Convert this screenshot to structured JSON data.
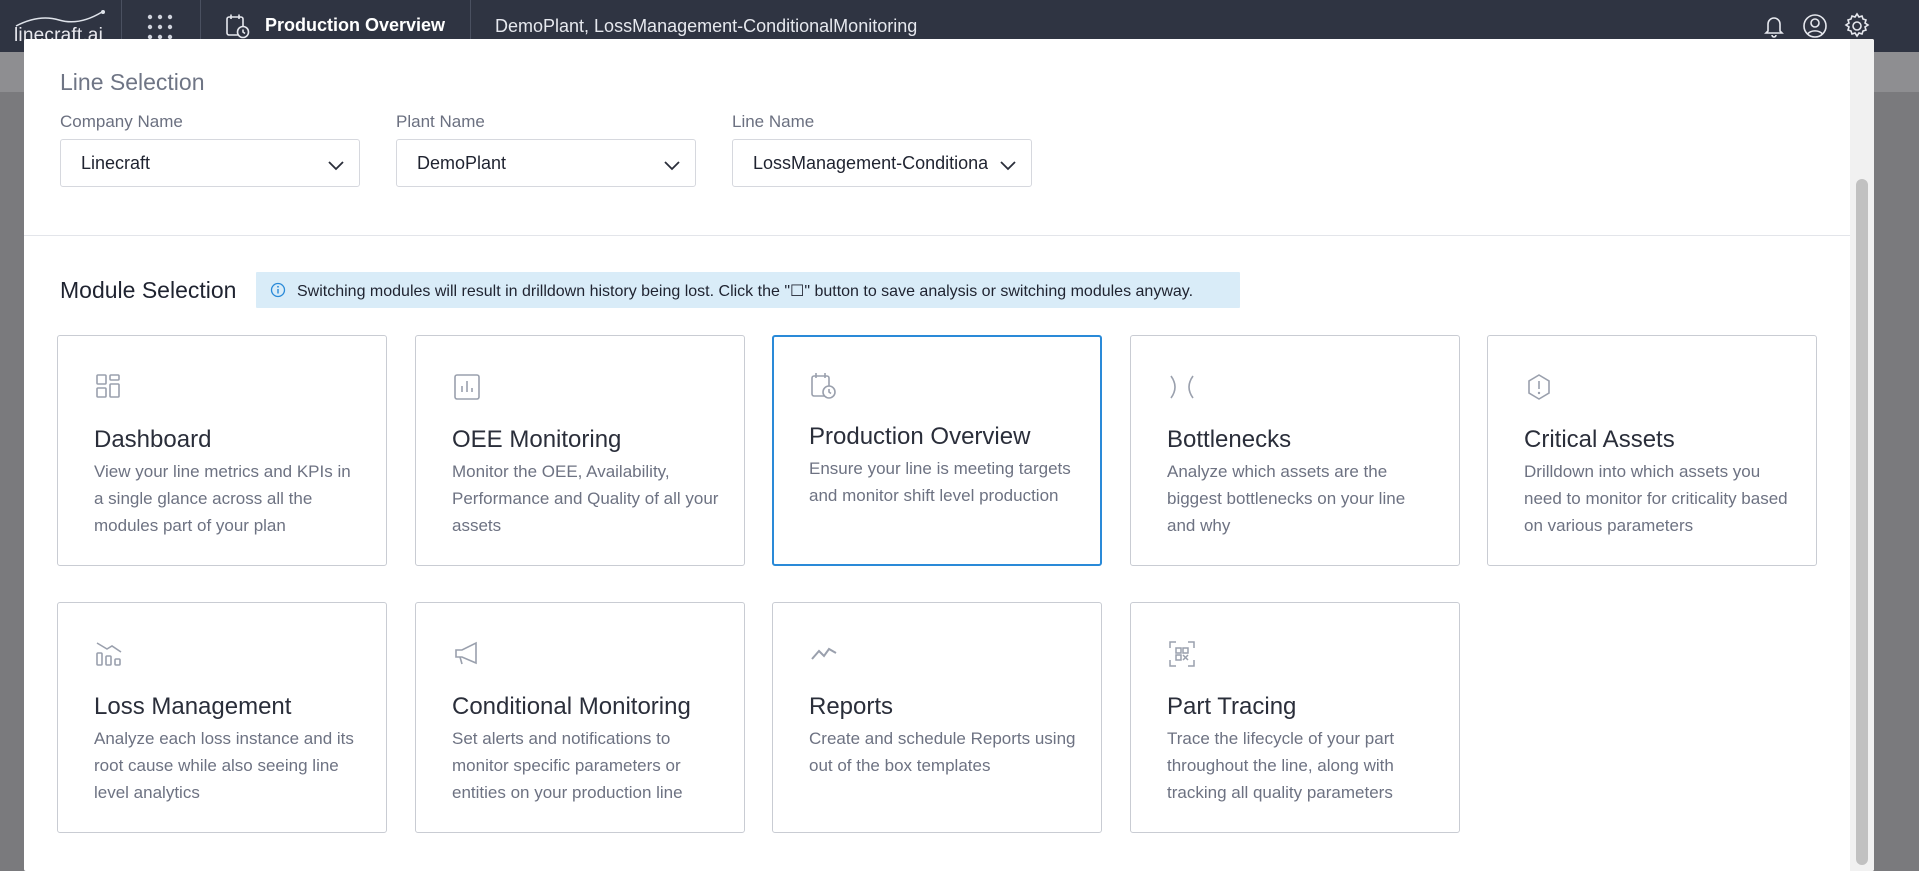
{
  "topbar": {
    "logo_text": "linecraft.ai",
    "app_title": "Production Overview",
    "context": "DemoPlant, LossManagement-ConditionalMonitoring",
    "icons": [
      "apps-grid-icon",
      "calendar-clock-icon",
      "bell-icon",
      "user-circle-icon",
      "gear-icon"
    ]
  },
  "line_selection": {
    "title": "Line Selection",
    "fields": [
      {
        "label": "Company Name",
        "value": "Linecraft"
      },
      {
        "label": "Plant Name",
        "value": "DemoPlant"
      },
      {
        "label": "Line Name",
        "value": "LossManagement-ConditionalMonitoring"
      }
    ]
  },
  "module_selection": {
    "title": "Module Selection",
    "info": "Switching modules will result in drilldown history being lost. Click the \"☐\" button to save analysis or switching modules anyway.",
    "modules": [
      {
        "title": "Dashboard",
        "desc": "View your line metrics and KPIs in a single glance across all the modules part of your plan",
        "icon": "dashboard-grid-icon",
        "selected": false
      },
      {
        "title": "OEE Monitoring",
        "desc": "Monitor the OEE, Availability, Performance and Quality of all your assets",
        "icon": "bar-chart-icon",
        "selected": false
      },
      {
        "title": "Production Overview",
        "desc": "Ensure your line is meeting targets and monitor shift level production",
        "icon": "calendar-clock-icon",
        "selected": true
      },
      {
        "title": "Bottlenecks",
        "desc": "Analyze which assets are the biggest bottlenecks on your line and why",
        "icon": "bottleneck-icon",
        "selected": false
      },
      {
        "title": "Critical Assets",
        "desc": "Drilldown into which assets you need to monitor for criticality based on various parameters",
        "icon": "alert-hexagon-icon",
        "selected": false
      },
      {
        "title": "Loss Management",
        "desc": "Analyze each loss instance and its root cause while also seeing line level analytics",
        "icon": "loss-chart-icon",
        "selected": false
      },
      {
        "title": "Conditional Monitoring",
        "desc": "Set alerts and notifications to monitor specific parameters or entities on your production line",
        "icon": "megaphone-icon",
        "selected": false
      },
      {
        "title": "Reports",
        "desc": "Create and schedule Reports using out of the box templates",
        "icon": "trend-line-icon",
        "selected": false
      },
      {
        "title": "Part Tracing",
        "desc": "Trace the lifecycle of your part throughout the line, along with tracking all quality parameters",
        "icon": "scan-icon",
        "selected": false
      }
    ]
  },
  "colors": {
    "topbar": "#2f3442",
    "selected_border": "#2a8ad8",
    "info_banner": "#d9ecf8"
  }
}
